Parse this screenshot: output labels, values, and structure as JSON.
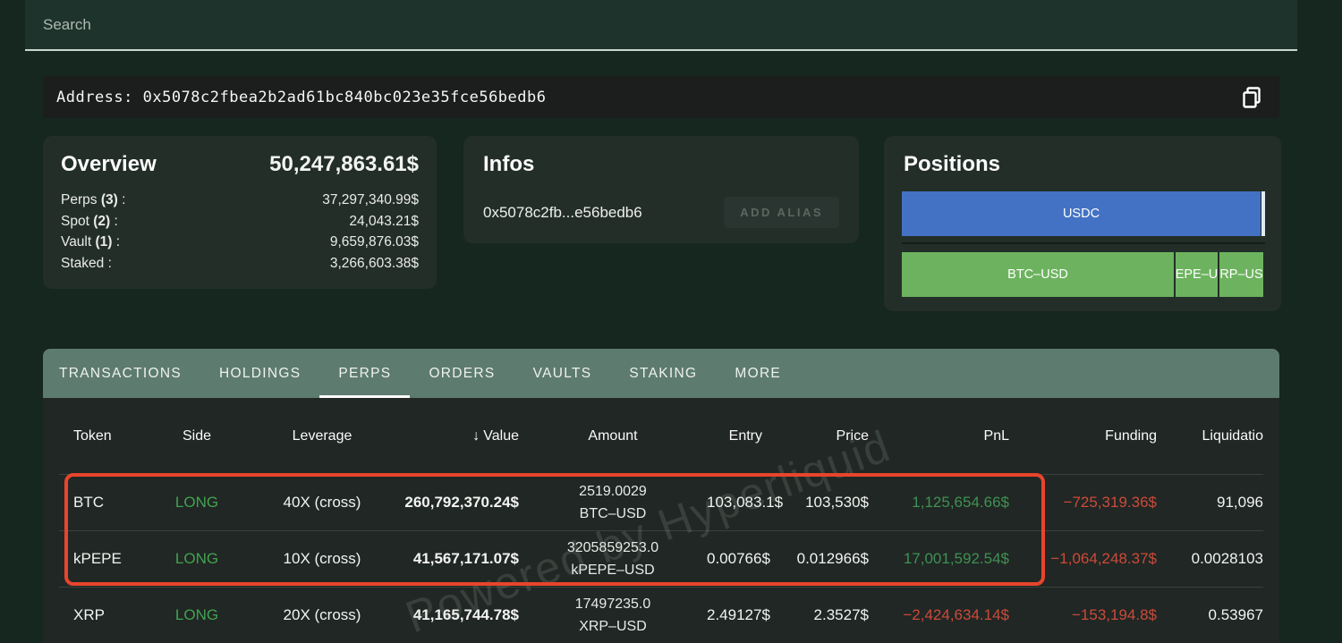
{
  "colors": {
    "page_bg": "#15271f",
    "card_bg": "#232e29",
    "tabbar_bg": "#5e7b70",
    "table_bg": "#212724",
    "long_green": "#41a350",
    "pnl_green": "#3f9154",
    "loss_red": "#cc4a3a",
    "annotation_red": "#e8452c",
    "usdc_blue": "#4372c4",
    "bar_green": "#6db35f"
  },
  "search": {
    "placeholder": "Search"
  },
  "address_bar": {
    "text": "Address: 0x5078c2fbea2b2ad61bc840bc023e35fce56bedb6"
  },
  "overview": {
    "title": "Overview",
    "total": "50,247,863.61$",
    "rows": [
      {
        "label": "Perps",
        "count": "(3)",
        "colon": ":",
        "value": "37,297,340.99$"
      },
      {
        "label": "Spot",
        "count": "(2)",
        "colon": ":",
        "value": "24,043.21$"
      },
      {
        "label": "Vault",
        "count": "(1)",
        "colon": ":",
        "value": "9,659,876.03$"
      },
      {
        "label": "Staked",
        "count": "",
        "colon": ":",
        "value": "3,266,603.38$"
      }
    ]
  },
  "infos": {
    "title": "Infos",
    "short_address": "0x5078c2fb...e56bedb6",
    "add_alias_label": "ADD ALIAS"
  },
  "positions": {
    "title": "Positions",
    "usdc_bar": {
      "label": "USDC"
    },
    "perp_bar": {
      "segments": [
        {
          "label": "BTC–USD"
        },
        {
          "label": "EPE–U"
        },
        {
          "label": "RP–US"
        }
      ]
    }
  },
  "tabs": {
    "active": "PERPS",
    "items": [
      {
        "label": "TRANSACTIONS"
      },
      {
        "label": "HOLDINGS"
      },
      {
        "label": "PERPS"
      },
      {
        "label": "ORDERS"
      },
      {
        "label": "VAULTS"
      },
      {
        "label": "STAKING"
      },
      {
        "label": "MORE"
      }
    ]
  },
  "table": {
    "headers": {
      "token": "Token",
      "side": "Side",
      "leverage": "Leverage",
      "sort_arrow": "↓",
      "value": "Value",
      "amount": "Amount",
      "entry": "Entry",
      "price": "Price",
      "pnl": "PnL",
      "funding": "Funding",
      "liquidation": "Liquidatio"
    },
    "rows": [
      {
        "token": "BTC",
        "side": "LONG",
        "leverage": "40X (cross)",
        "value": "260,792,370.24$",
        "amount": "2519.0029",
        "pair": "BTC–USD",
        "entry": "103,083.1$",
        "price": "103,530$",
        "pnl": "1,125,654.66$",
        "pnl_positive": true,
        "funding": "−725,319.36$",
        "liquidation": "91,096"
      },
      {
        "token": "kPEPE",
        "side": "LONG",
        "leverage": "10X (cross)",
        "value": "41,567,171.07$",
        "amount": "3205859253.0",
        "pair": "kPEPE–USD",
        "entry": "0.00766$",
        "price": "0.012966$",
        "pnl": "17,001,592.54$",
        "pnl_positive": true,
        "funding": "−1,064,248.37$",
        "liquidation": "0.0028103"
      },
      {
        "token": "XRP",
        "side": "LONG",
        "leverage": "20X (cross)",
        "value": "41,165,744.78$",
        "amount": "17497235.0",
        "pair": "XRP–USD",
        "entry": "2.49127$",
        "price": "2.3527$",
        "pnl": "−2,424,634.14$",
        "pnl_positive": false,
        "funding": "−153,194.8$",
        "liquidation": "0.53967"
      }
    ]
  },
  "annotation": {
    "rows_highlighted": [
      "BTC",
      "kPEPE"
    ]
  },
  "watermark": {
    "text": "Powered by Hyperliquid"
  }
}
